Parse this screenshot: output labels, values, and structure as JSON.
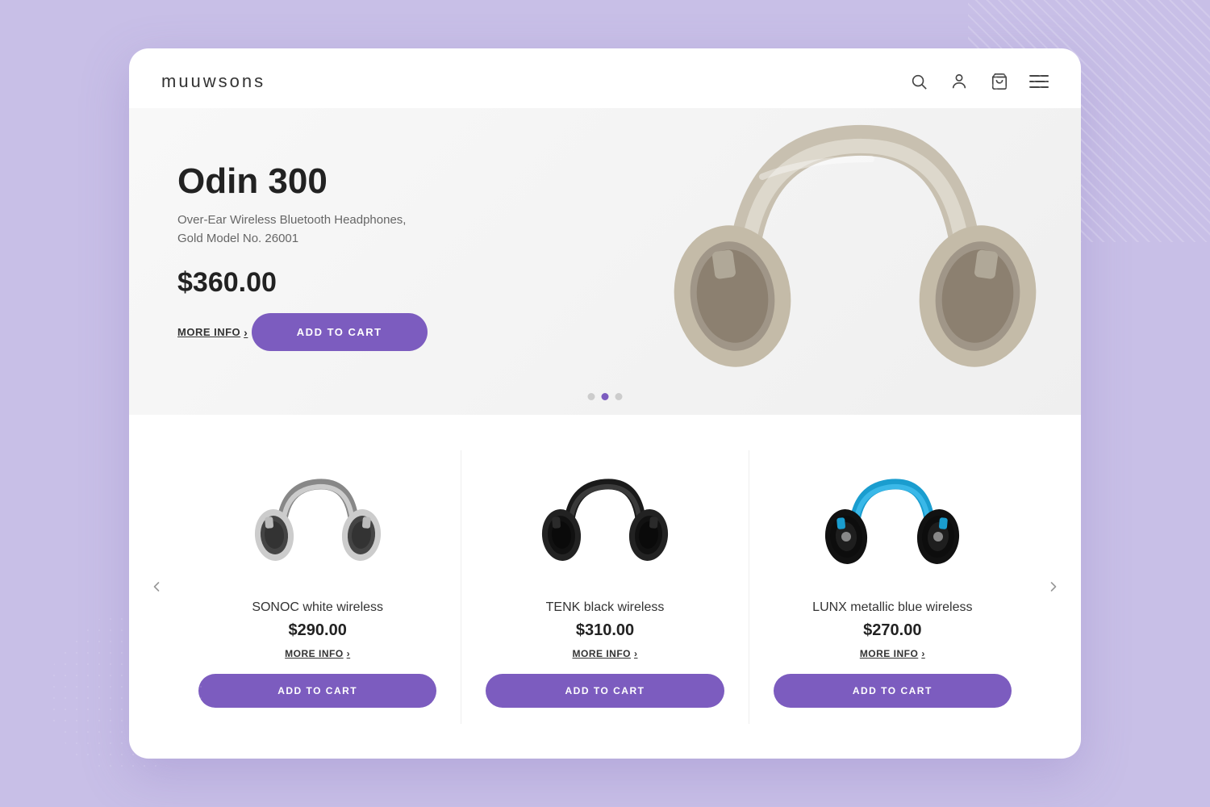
{
  "brand": {
    "logo": "muuwsons"
  },
  "header": {
    "icons": [
      "search",
      "user",
      "cart",
      "menu"
    ]
  },
  "hero": {
    "title": "Odin 300",
    "subtitle_line1": "Over-Ear Wireless Bluetooth Headphones,",
    "subtitle_line2": "Gold Model No. 26001",
    "price": "$360.00",
    "more_info_label": "MORE INFO",
    "add_to_cart_label": "ADD TO CART",
    "dots": [
      {
        "active": false
      },
      {
        "active": true
      },
      {
        "active": false
      }
    ]
  },
  "products": [
    {
      "name": "SONOC white wireless",
      "price": "$290.00",
      "more_info_label": "MORE INFO",
      "add_to_cart_label": "ADD TO CART",
      "color_primary": "#ffffff",
      "color_secondary": "#222222"
    },
    {
      "name": "TENK black wireless",
      "price": "$310.00",
      "more_info_label": "MORE INFO",
      "add_to_cart_label": "ADD TO CART",
      "color_primary": "#222222",
      "color_secondary": "#111111"
    },
    {
      "name": "LUNX metallic blue wireless",
      "price": "$270.00",
      "more_info_label": "MORE INFO",
      "add_to_cart_label": "ADD TO CART",
      "color_primary": "#1e9ecf",
      "color_secondary": "#111111"
    }
  ],
  "nav": {
    "prev_label": "‹",
    "next_label": "›"
  }
}
